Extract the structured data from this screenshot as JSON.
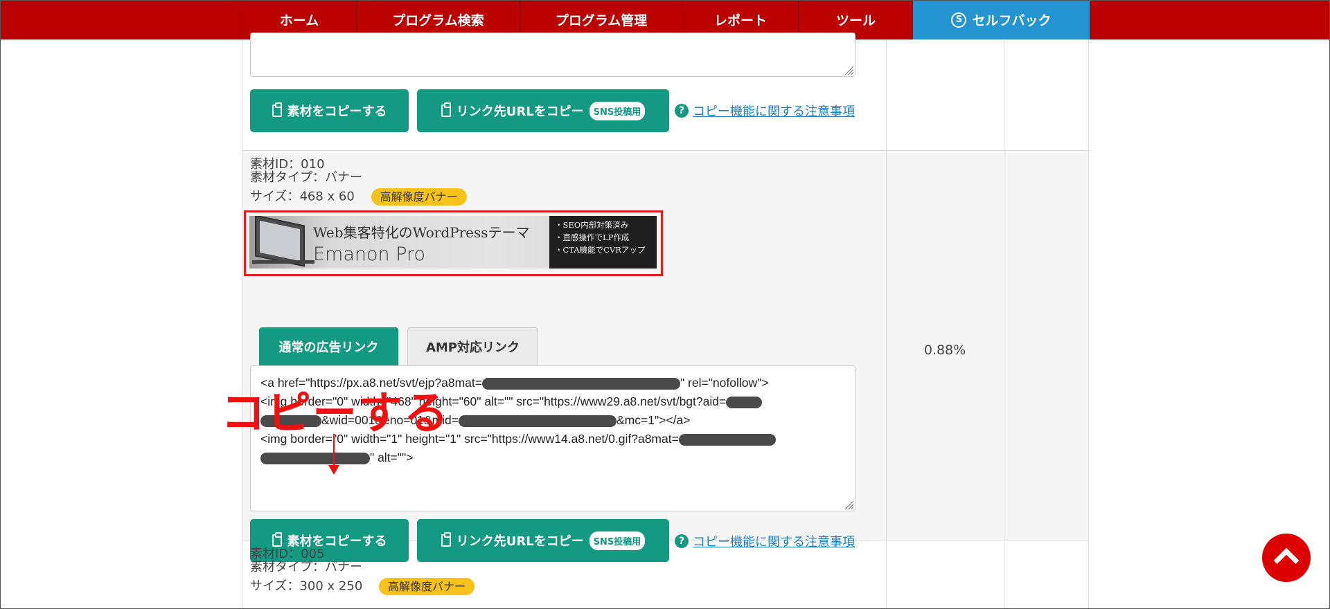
{
  "nav": {
    "items": [
      "ホーム",
      "プログラム検索",
      "プログラム管理",
      "レポート",
      "ツール"
    ],
    "selfback_label": "セルフバック",
    "selfback_icon": "s-circle-icon"
  },
  "buttons": {
    "copy_material": "素材をコピーする",
    "copy_url": "リンク先URLをコピー",
    "sns_badge": "SNS投稿用",
    "note_link": "コピー機能に関する注意事項"
  },
  "material_010": {
    "id_line": "素材ID：010",
    "type_line": "素材タイプ：バナー",
    "size_line": "サイズ：468 x 60",
    "badge": "高解像度バナー",
    "banner_title": "Web集客特化のWordPressテーマ",
    "banner_logo": "Emanon Pro",
    "banner_points": [
      "・SEO内部対策済み",
      "・直感操作でLP作成",
      "・CTA機能でCVRアップ"
    ],
    "tabs": [
      "通常の広告リンク",
      "AMP対応リンク"
    ],
    "code": {
      "l1a": "<a href=\"https://px.a8.net/svt/ejp?a8mat=",
      "l1b": "\" rel=\"nofollow\">",
      "l2a": "<img border=\"0\" width=\"468\" height=\"60\" alt=\"\" src=\"https://www29.a8.net/svt/bgt?aid=",
      "l3a": "&wid=001&eno=01&mid=",
      "l3b": "&mc=1\"></a>",
      "l4a": "<img border=\"0\" width=\"1\" height=\"1\" src=\"https://www14.a8.net/0.gif?a8mat=",
      "l5b": "\" alt=\"\">"
    },
    "rate": "0.88%"
  },
  "material_005": {
    "id_line": "素材ID：005",
    "type_line": "素材タイプ：バナー",
    "size_line": "サイズ：300 x 250",
    "badge": "高解像度バナー"
  },
  "annotation": {
    "text": "コピーする",
    "color": "#f01010"
  },
  "colors": {
    "nav_red": "#bb0000",
    "selfback_blue": "#2595d1",
    "button_teal": "#149982",
    "badge_yellow": "#f8c21a",
    "link_blue": "#1a7fc6"
  }
}
